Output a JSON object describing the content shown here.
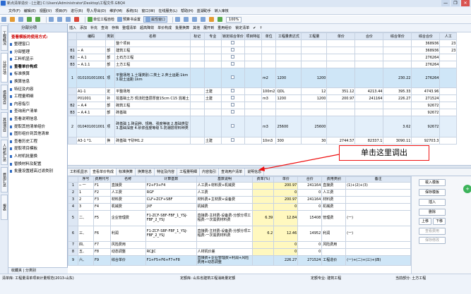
{
  "window": {
    "title": "新点清单造价 - [土建] C:\\Users\\Administrator\\Desktop\\工程文件.GBQ4",
    "controls": [
      "—",
      "❐",
      "✕"
    ]
  },
  "menu": [
    "文件(F)",
    "编辑(E)",
    "视图(V)",
    "项目(P)",
    "进行(R)",
    "导入导出(D)",
    "维护(M)",
    "系统(S)",
    "窗口(W)",
    "在线服务(L)",
    "帮助(H)",
    "蓝湖助手",
    "转入审核"
  ],
  "toolbar": [
    "单位工程自检",
    "预算书设置",
    "属性窗口",
    "100%"
  ],
  "left_tabs": [
    "工程概况",
    "分部分项",
    "措施项目",
    "其他项目",
    "人材机汇总",
    "费用汇总",
    "报表"
  ],
  "sidebar": {
    "header": "分部分项",
    "hint": "查看模板的使用方式:",
    "items": [
      "整理窗口",
      "分部整理",
      "工料机显示",
      "查看单价构成",
      "标准换算",
      "换算信息",
      "特征及内容",
      "工程量明细",
      "内容指引",
      "查询用户清单",
      "查看说明信息",
      "提取其他清单组价",
      "图形组价到其他清单",
      "查看历史工程",
      "提取项目模板",
      "人材机批量换",
      "替换材料及配置",
      "批量设置超高过滤类别"
    ],
    "active_index": 3,
    "footer": "收藏夹 | 分类别"
  },
  "subtoolbar": [
    "插入",
    "添加",
    "补充",
    "查询",
    "存档",
    "整理清单",
    "超高降效",
    "单价构成",
    "批量换算",
    "其他",
    "展开到",
    "重用组价",
    "锁定清单",
    "✔",
    "↑"
  ],
  "main_table": {
    "headers": [
      "",
      "编码",
      "类别",
      "名称",
      "标记",
      "专业",
      "锁定综合单价",
      "项目特征",
      "单位",
      "工程量表达式",
      "工程量",
      "单价",
      "合价",
      "综合单价",
      "综合合价",
      "人工"
    ],
    "rows": [
      {
        "rn": "",
        "code": "",
        "type": "",
        "name": "整个项目",
        "unit": "",
        "expr": "",
        "qty": "",
        "price": "",
        "total": "",
        "uprice": "",
        "utotal": "368936",
        "labor": "23"
      },
      {
        "rn": "B1",
        "code": "─ A",
        "type": "部",
        "name": "建筑工程",
        "unit": "",
        "expr": "",
        "qty": "",
        "price": "",
        "total": "",
        "uprice": "",
        "utotal": "368936",
        "labor": "23"
      },
      {
        "rn": "B2",
        "code": "─ A.1",
        "type": "部",
        "name": "土石方工程",
        "unit": "",
        "expr": "",
        "qty": "",
        "price": "",
        "total": "",
        "uprice": "",
        "utotal": "276264",
        "labor": ""
      },
      {
        "rn": "B3",
        "code": "─ A.1.1",
        "type": "部",
        "name": "土方工程",
        "unit": "",
        "expr": "",
        "qty": "",
        "price": "",
        "total": "",
        "uprice": "",
        "utotal": "276264",
        "labor": ""
      },
      {
        "rn": "1",
        "code": "010101001001",
        "type": "项",
        "name": "平整场地 1.土壤类别:二类土 2.弃土运距:1km 3.取土运距:1km",
        "unit": "m2",
        "expr": "1200",
        "qty": "1200",
        "price": "",
        "total": "",
        "uprice": "230.22",
        "utotal": "276264",
        "labor": ""
      },
      {
        "rn": "",
        "code": "A1-1",
        "type": "定",
        "name": "平整场地",
        "spec": "土建",
        "unit": "100m2",
        "expr": "QDL",
        "qty": "12",
        "price": "351.12",
        "total": "4213.44",
        "uprice": "395.33",
        "utotal": "4743.96",
        "labor": ""
      },
      {
        "rn": "",
        "code": "P01001",
        "type": "补",
        "name": "挖基础土方 现浇砼垫层厚度15cm C15 混凝土",
        "spec": "土建",
        "unit": "m3",
        "expr": "1200",
        "qty": "1200",
        "price": "200.97",
        "total": "241164",
        "uprice": "226.27",
        "utotal": "271524",
        "labor": ""
      },
      {
        "rn": "B2",
        "code": "─ A.4",
        "type": "部",
        "name": "砌筑工程",
        "unit": "",
        "expr": "",
        "qty": "",
        "price": "",
        "total": "",
        "uprice": "",
        "utotal": "92672",
        "labor": ""
      },
      {
        "rn": "B3",
        "code": "─ A.4.1",
        "type": "部",
        "name": "砖基础",
        "unit": "",
        "expr": "",
        "qty": "",
        "price": "",
        "total": "",
        "uprice": "",
        "utotal": "92672",
        "labor": ""
      },
      {
        "rn": "2",
        "code": "010401001001",
        "type": "项",
        "name": "砖基础 1.砖品种、规格、强度等级 2.基础类型 3.基础深度 4.砂浆强度等级 5.防潮层材料种类",
        "unit": "m3",
        "expr": "25600",
        "qty": "25600",
        "price": "",
        "total": "",
        "uprice": "3.62",
        "utotal": "92672",
        "labor": ""
      },
      {
        "rn": "",
        "code": "A3-1 *1.",
        "type": "换",
        "name": "砖基础 干砂M1.2",
        "spec": "土建",
        "unit": "10m3",
        "expr": "300",
        "qty": "30",
        "price": "2744.57",
        "total": "82337.1",
        "uprice": "3090.11",
        "utotal": "92703.3",
        "labor": ""
      }
    ],
    "selected_index": 4
  },
  "bottom_tabs": [
    "工料机显示",
    "查看单价构成",
    "标准换算",
    "换算信息",
    "特征及内容",
    "工程量明细",
    "内容指引",
    "查询用户清单",
    "说明信息"
  ],
  "bottom_active": 1,
  "bottom_table": {
    "headers": [
      "",
      "序号",
      "费用代号",
      "名称",
      "计算基数",
      "基数说明",
      "费率(%)",
      "单价",
      "合价",
      "费用类别",
      "备注"
    ],
    "rows": [
      {
        "rn": "1",
        "seq": "─ 一",
        "code": "F1",
        "name": "直接费",
        "base": "F2+F3+F4",
        "desc": "人工费+材料费+机械费",
        "rate": "",
        "price": "200.97",
        "total": "241164",
        "cat": "直接费",
        "note": "(1)+(2)+(3)"
      },
      {
        "rn": "2",
        "seq": "1",
        "code": "F2",
        "name": "人工费",
        "base": "RGF",
        "desc": "人工费",
        "rate": "",
        "price": "0",
        "total": "0",
        "cat": "人工费",
        "note": ""
      },
      {
        "rn": "3",
        "seq": "2",
        "code": "F3",
        "name": "材料费",
        "base": "CLF+ZCF+SBF",
        "desc": "材料费+主材费+设备费",
        "rate": "",
        "price": "200.97",
        "total": "241164",
        "cat": "材料费",
        "note": ""
      },
      {
        "rn": "4",
        "seq": "3",
        "code": "F4",
        "name": "机械费",
        "base": "JXF",
        "desc": "机械费",
        "rate": "",
        "price": "0",
        "total": "0",
        "cat": "机械费",
        "note": ""
      },
      {
        "rn": "5",
        "seq": "二、",
        "code": "F5",
        "name": "企业管理费",
        "base": "F1-ZCF-SBF-FBF_1_YSJ-FBF_2_YSJ",
        "desc": "直接费-主材费-设备费-分部分项工程费-一次需费材料费",
        "rate": "6.39",
        "price": "12.84",
        "total": "15408",
        "cat": "管理费",
        "note": "(一)"
      },
      {
        "rn": "6",
        "seq": "三、",
        "code": "F6",
        "name": "利润",
        "base": "F1-ZCF-SBF-FBF_1_YSJ-FBF_2_YSJ",
        "desc": "直接费-主材费-设备费-分部分项工程费-一次需费材料费",
        "rate": "6.2",
        "price": "12.46",
        "total": "14952",
        "cat": "利润",
        "note": "(一)"
      },
      {
        "rn": "7",
        "seq": "四、",
        "code": "F7",
        "name": "风险费用",
        "base": "",
        "desc": "",
        "rate": "",
        "price": "0",
        "total": "0",
        "cat": "风险费用",
        "note": ""
      },
      {
        "rn": "8",
        "seq": "五、",
        "code": "F8",
        "name": "动态调整",
        "base": "RCJJC",
        "desc": "人材机价差",
        "rate": "",
        "price": "0",
        "total": "0",
        "cat": "",
        "note": ""
      },
      {
        "rn": "9",
        "seq": "六、",
        "code": "F9",
        "name": "综合单价",
        "base": "F1+F5+F6+F7+F8",
        "desc": "直接费+企业管理费+利润+风险费用+动态调整",
        "rate": "",
        "price": "226.27",
        "total": "271524",
        "cat": "工程造价",
        "note": "(一)+(二)+(三)+(四)"
      }
    ],
    "selected_index": 8
  },
  "right_buttons": [
    "载入模板",
    "保存模板",
    "插入",
    "删除",
    "上移",
    "下移",
    "查看费用",
    "保存修改"
  ],
  "status": [
    "清单库: 工程量清单项目计量规范(2013-山东)",
    "定额库: 山东省建筑工程消耗量定额",
    "定额专业: 建筑工程",
    "当前部分: 土方工程"
  ],
  "annotation": "单击这里调出",
  "colors": {
    "accent": "#2f6bc3",
    "selected_row": "#cfe6f7",
    "highlight_cell": "#fff8bf",
    "callout_border": "#e11111"
  }
}
